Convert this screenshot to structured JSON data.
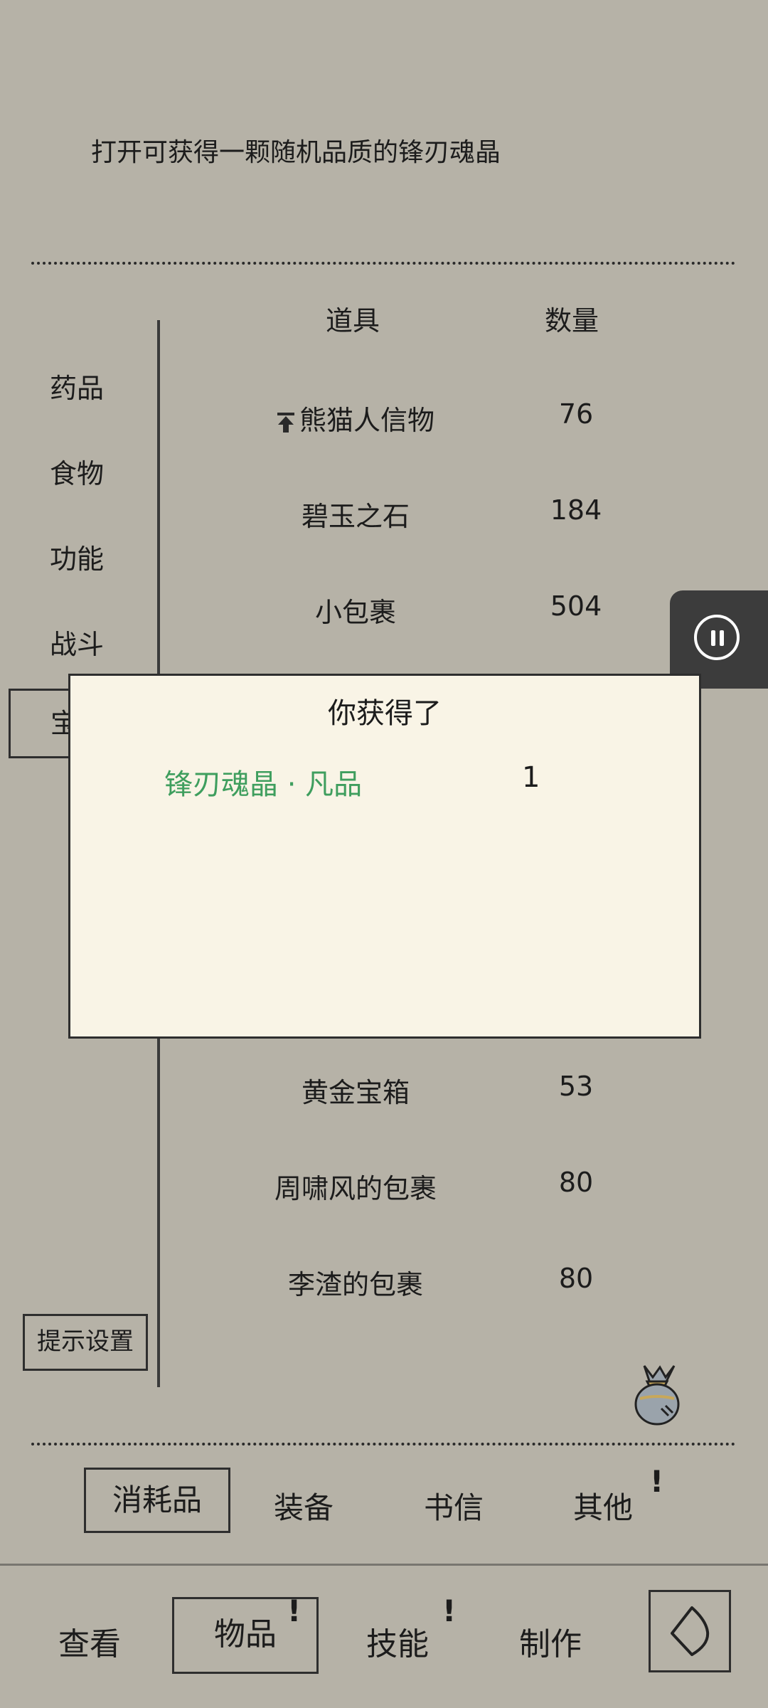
{
  "description": "打开可获得一颗随机品质的锋刃魂晶",
  "table_headers": {
    "item": "道具",
    "qty": "数量"
  },
  "categories": [
    "药品",
    "食物",
    "功能",
    "战斗"
  ],
  "selected_category_partial": "宝",
  "items_top": [
    {
      "name": "熊猫人信物",
      "qty": "76",
      "pinned": true
    },
    {
      "name": "碧玉之石",
      "qty": "184"
    },
    {
      "name": "小包裹",
      "qty": "504"
    }
  ],
  "items_bottom": [
    {
      "name": "黄金宝箱",
      "qty": "53"
    },
    {
      "name": "周啸风的包裹",
      "qty": "80"
    },
    {
      "name": "李渣的包裹",
      "qty": "80"
    }
  ],
  "hint_settings_label": "提示设置",
  "subtabs": [
    "消耗品",
    "装备",
    "书信",
    "其他"
  ],
  "subtab_marks": {
    "other": "!"
  },
  "nav": [
    "查看",
    "物品",
    "技能",
    "制作"
  ],
  "nav_marks": {
    "items": "!",
    "skills": "!"
  },
  "dialog": {
    "title": "你获得了",
    "item_name": "锋刃魂晶 · 凡品",
    "item_qty": "1"
  },
  "colors": {
    "background": "#b6b2a7",
    "dialog_bg": "#f9f4e6",
    "rarity_green": "#3f9e5e",
    "pause_bg": "#3c3c3c"
  },
  "icons": {
    "pause": "pause-icon",
    "back": "back-icon",
    "bag": "item-bag-icon",
    "pin": "up-arrow-icon"
  }
}
